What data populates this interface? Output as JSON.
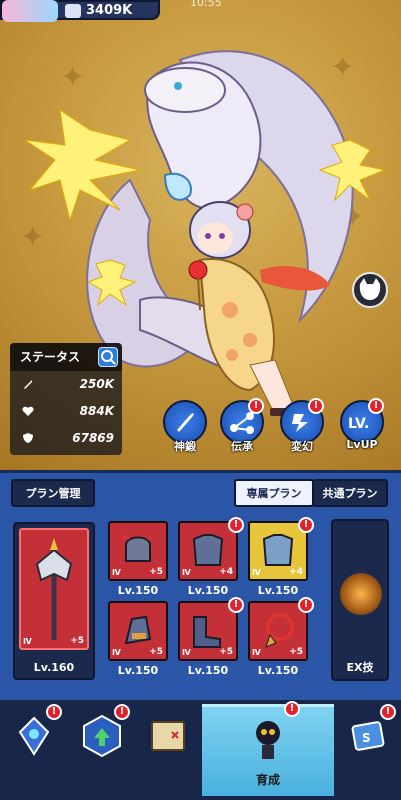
{
  "header": {
    "power": "3409K",
    "clock": "10:55"
  },
  "status": {
    "title": "ステータス",
    "rows": [
      {
        "icon": "sword-icon",
        "value": "250K"
      },
      {
        "icon": "heart-icon",
        "value": "884K"
      },
      {
        "icon": "shield-icon",
        "value": "67869"
      }
    ]
  },
  "actions": [
    {
      "icon": "sword-icon",
      "label": "神鍛",
      "badge": false
    },
    {
      "icon": "network-icon",
      "label": "伝承",
      "badge": true
    },
    {
      "icon": "transform-icon",
      "label": "変幻",
      "badge": true
    },
    {
      "icon": "level-up-icon",
      "label": "LvUP",
      "badge": true
    }
  ],
  "panel": {
    "plan_button": "プラン管理",
    "tabs": [
      {
        "label": "専属プラン",
        "active": true
      },
      {
        "label": "共通プラン",
        "active": false
      }
    ],
    "weapon": {
      "rank": "Ⅳ",
      "plus": "+5",
      "level": "Lv.160"
    },
    "gear": [
      {
        "name": "helmet",
        "rank": "Ⅳ",
        "plus": "+5",
        "level": "Lv.150",
        "color": "#c33037"
      },
      {
        "name": "armor",
        "rank": "Ⅳ",
        "plus": "+4",
        "level": "Lv.150",
        "color": "#c33037"
      },
      {
        "name": "armor-gold",
        "rank": "Ⅳ",
        "plus": "+4",
        "level": "Lv.150",
        "color": "#e6c53a"
      },
      {
        "name": "gauntlet",
        "rank": "Ⅳ",
        "plus": "+5",
        "level": "Lv.150",
        "color": "#c33037"
      },
      {
        "name": "boots",
        "rank": "Ⅳ",
        "plus": "+5",
        "level": "Lv.150",
        "color": "#c33037"
      },
      {
        "name": "necklace",
        "rank": "Ⅳ",
        "plus": "+5",
        "level": "Lv.150",
        "color": "#c33037"
      }
    ],
    "ex_label": "EX技"
  },
  "nav": {
    "items": [
      {
        "icon": "crystal-icon",
        "label": "",
        "badge": true
      },
      {
        "icon": "upgrade-icon",
        "label": "",
        "badge": true
      },
      {
        "icon": "map-icon",
        "label": "",
        "badge": false
      },
      {
        "icon": "character-icon",
        "label": "育成",
        "badge": true,
        "active": true
      },
      {
        "icon": "cards-icon",
        "label": "",
        "badge": true
      }
    ]
  }
}
